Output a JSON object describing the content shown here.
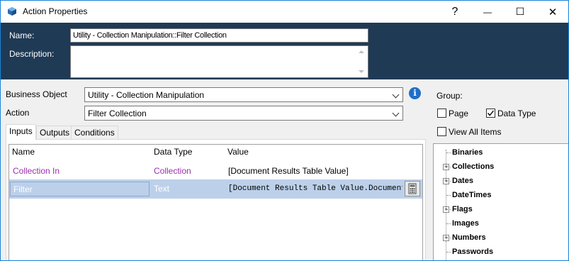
{
  "window": {
    "title": "Action Properties",
    "help_glyph": "?",
    "minimize_glyph": "—",
    "maximize_glyph": "☐",
    "close_glyph": "✕"
  },
  "header": {
    "name_label": "Name:",
    "name_value": "Utility - Collection Manipulation::Filter Collection",
    "description_label": "Description:",
    "description_value": ""
  },
  "business_object": {
    "label": "Business Object",
    "value": "Utility - Collection Manipulation"
  },
  "action": {
    "label": "Action",
    "value": "Filter Collection"
  },
  "tabs": [
    {
      "label": "Inputs",
      "active": true
    },
    {
      "label": "Outputs",
      "active": false
    },
    {
      "label": "Conditions",
      "active": false
    }
  ],
  "grid": {
    "columns": [
      "Name",
      "Data Type",
      "Value"
    ],
    "rows": [
      {
        "name": "Collection In",
        "type": "Collection",
        "value": "[Document Results Table Value]"
      },
      {
        "name": "Filter",
        "type": "Text",
        "value": "[Document Results Table Value.Document Na"
      }
    ]
  },
  "group": {
    "label": "Group:",
    "page": {
      "label": "Page",
      "checked": false
    },
    "data_type": {
      "label": "Data Type",
      "checked": true
    },
    "view_all": {
      "label": "View All Items",
      "checked": false
    }
  },
  "tree": {
    "items": [
      {
        "label": "Binaries",
        "expandable": false
      },
      {
        "label": "Collections",
        "expandable": true
      },
      {
        "label": "Dates",
        "expandable": true
      },
      {
        "label": "DateTimes",
        "expandable": false
      },
      {
        "label": "Flags",
        "expandable": true
      },
      {
        "label": "Images",
        "expandable": false
      },
      {
        "label": "Numbers",
        "expandable": true
      },
      {
        "label": "Passwords",
        "expandable": false
      }
    ]
  },
  "colors": {
    "header_bg": "#1f3a55",
    "row_name_color": "#9b2fae",
    "selection": "#bcd0ea",
    "accent": "#1883d7"
  }
}
